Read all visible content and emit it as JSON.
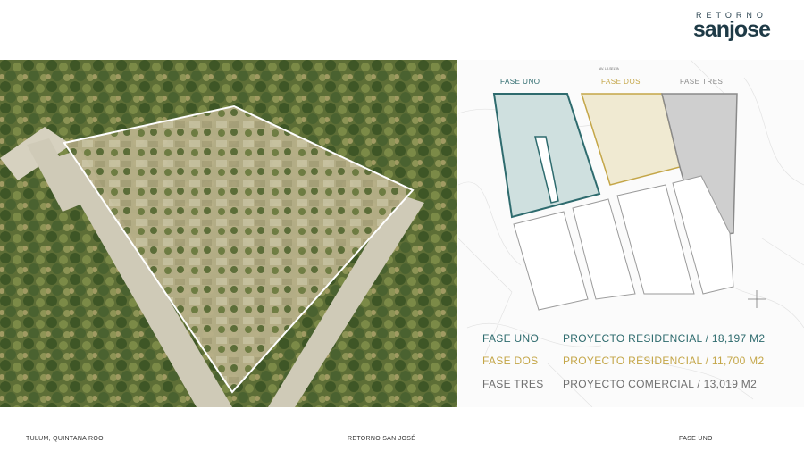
{
  "brand": {
    "top": "RETORNO",
    "name": "sanjose"
  },
  "plan": {
    "labels": {
      "uno": "FASE UNO",
      "dos": "FASE DOS",
      "tres": "FASE TRES",
      "north_road": "AV. LA SELVA"
    },
    "colors": {
      "uno": "#2e6b6e",
      "dos": "#c4a648",
      "tres": "#8a8a8a"
    }
  },
  "legend": [
    {
      "name": "FASE UNO",
      "desc": "PROYECTO RESIDENCIAL / 18,197 M2",
      "color": "#2e6b6e"
    },
    {
      "name": "FASE DOS",
      "desc": "PROYECTO RESIDENCIAL / 11,700 M2",
      "color": "#c4a648"
    },
    {
      "name": "FASE TRES",
      "desc": "PROYECTO COMERCIAL  /  13,019 M2",
      "color": "#6f6f6f"
    }
  ],
  "footer": {
    "left": "TULUM, QUINTANA ROO",
    "center": "RETORNO SAN JOSÉ",
    "right": "FASE UNO"
  }
}
